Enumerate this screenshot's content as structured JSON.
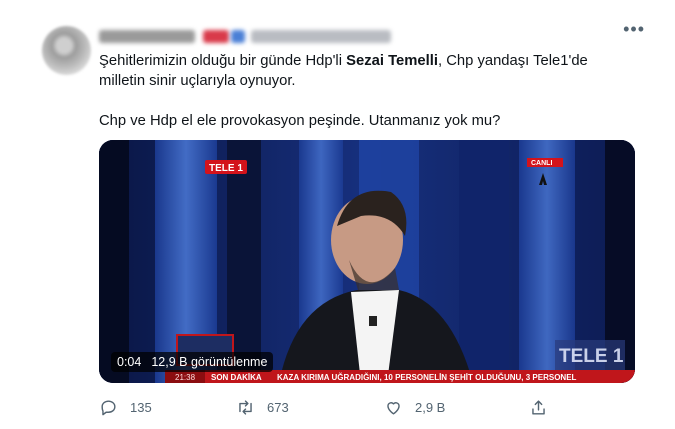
{
  "tweet": {
    "more_icon": "ellipsis-icon",
    "text": {
      "line1_before": "Şehitlerimizin olduğu bir günde Hdp'li ",
      "mention": "Sezai Temelli",
      "line1_after": ", Chp yandaşı Tele1'de",
      "line2": "milletin sinir uçlarıyla oynuyor.",
      "line3": "Chp ve Hdp el ele provokasyon peşinde. Utanmanız yok mu?"
    },
    "video": {
      "elapsed": "0:04",
      "views": "12,9 B görüntülenme",
      "channel_logo_left": "TELE 1",
      "channel_logo_right": "TELE 1",
      "live_badge": "CANLI",
      "ticker_time": "21:38",
      "ticker_label": "SON DAKİKA",
      "ticker_text": "KAZA KIRIMA UĞRADIĞINI, 10 PERSONELİN ŞEHİT OLDUĞUNU, 3 PERSONEL",
      "colors": {
        "background": "#0d1c4a",
        "ticker": "#c0161b",
        "panel": "#2a55b8"
      }
    },
    "actions": {
      "reply_count": "135",
      "retweet_count": "673",
      "like_count": "2,9 B",
      "reply_icon": "reply-icon",
      "retweet_icon": "retweet-icon",
      "like_icon": "heart-icon",
      "share_icon": "share-icon"
    }
  }
}
